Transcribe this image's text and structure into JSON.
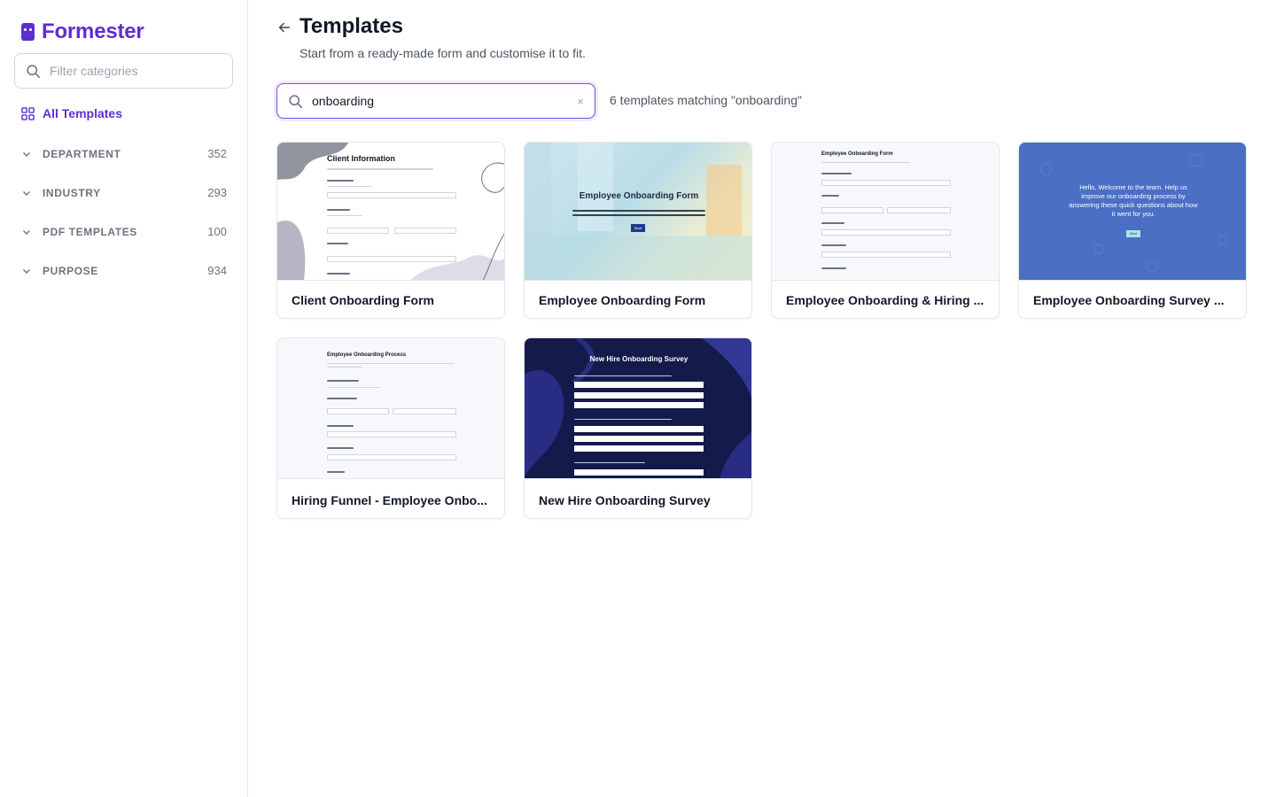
{
  "app": {
    "name": "Formester"
  },
  "sidebar": {
    "filter_placeholder": "Filter categories",
    "all_templates": "All Templates",
    "categories": [
      {
        "label": "DEPARTMENT",
        "count": "352"
      },
      {
        "label": "INDUSTRY",
        "count": "293"
      },
      {
        "label": "PDF TEMPLATES",
        "count": "100"
      },
      {
        "label": "PURPOSE",
        "count": "934"
      }
    ]
  },
  "header": {
    "title": "Templates",
    "subtitle": "Start from a ready-made form and customise it to fit."
  },
  "search": {
    "value": "onboarding",
    "clear": "×",
    "results_text": "6 templates matching \"onboarding\""
  },
  "cards": [
    {
      "name": "Client Onboarding Form",
      "thumb_title": "Client Information"
    },
    {
      "name": "Employee Onboarding Form",
      "thumb_title": "Employee Onboarding Form",
      "thumb_button": "Start"
    },
    {
      "name": "Employee Onboarding & Hiring ...",
      "thumb_title": "Employee Onboarding Form"
    },
    {
      "name": "Employee Onboarding Survey ...",
      "thumb_title": "Hello, Welcome to the team. Help us improve our onboarding process by answering these quick questions about how it went for you.",
      "thumb_button": "Next"
    },
    {
      "name": "Hiring Funnel - Employee Onbo...",
      "thumb_title": "Employee Onboarding Process"
    },
    {
      "name": "New Hire Onboarding Survey",
      "thumb_title": "New Hire Onboarding Survey"
    }
  ],
  "colors": {
    "accent": "#5b2fd1",
    "survey_blue": "#4a6fc3",
    "dark_navy": "#141a4a"
  }
}
